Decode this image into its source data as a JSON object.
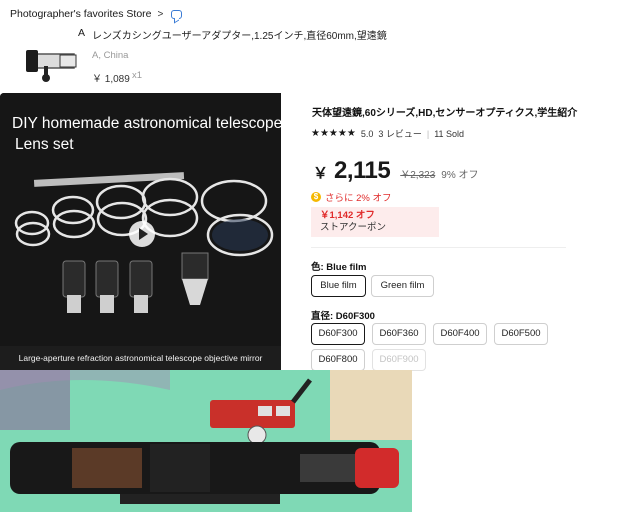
{
  "store": {
    "name": "Photographer's favorites Store",
    "chevron": ">"
  },
  "order": {
    "marker": "A",
    "title": "レンズカシングユーザーアダプター,1.25インチ,直径60mm,望遠鏡",
    "origin": "A, China",
    "price": "￥ 1,089",
    "quantity": "x1"
  },
  "photo": {
    "headline_line1": "DIY homemade astronomical telescope",
    "headline_line2": "Lens set",
    "caption": "Large-aperture refraction astronomical telescope objective mirror"
  },
  "product": {
    "title": "天体望遠鏡,60シリーズ,HD,センサーオプティクス,学生紹介",
    "stars": "★★★★★",
    "rating": "5.0",
    "reviews": "3 レビュー",
    "sold": "11 Sold",
    "currency": "￥",
    "price": "2,115",
    "old_price": "￥2,323",
    "discount": "9% オフ",
    "extra_discount": "さらに 2% オフ",
    "coupon_amount": "￥1,142 オフ",
    "coupon_label": "ストアクーポン"
  },
  "color": {
    "label": "色: Blue film",
    "options": [
      "Blue film",
      "Green film"
    ],
    "selected": "Blue film"
  },
  "size": {
    "label": "直径: D60F300",
    "options": [
      "D60F300",
      "D60F360",
      "D60F400",
      "D60F500",
      "D60F800",
      "D60F900"
    ],
    "selected": "D60F300",
    "disabled": [
      "D60F900"
    ]
  },
  "colors": {
    "price_red": "#e02b2b",
    "coupon_bg": "#fdecec",
    "photo_bg": "#141414",
    "cloth_green": "#7fd9b5"
  }
}
